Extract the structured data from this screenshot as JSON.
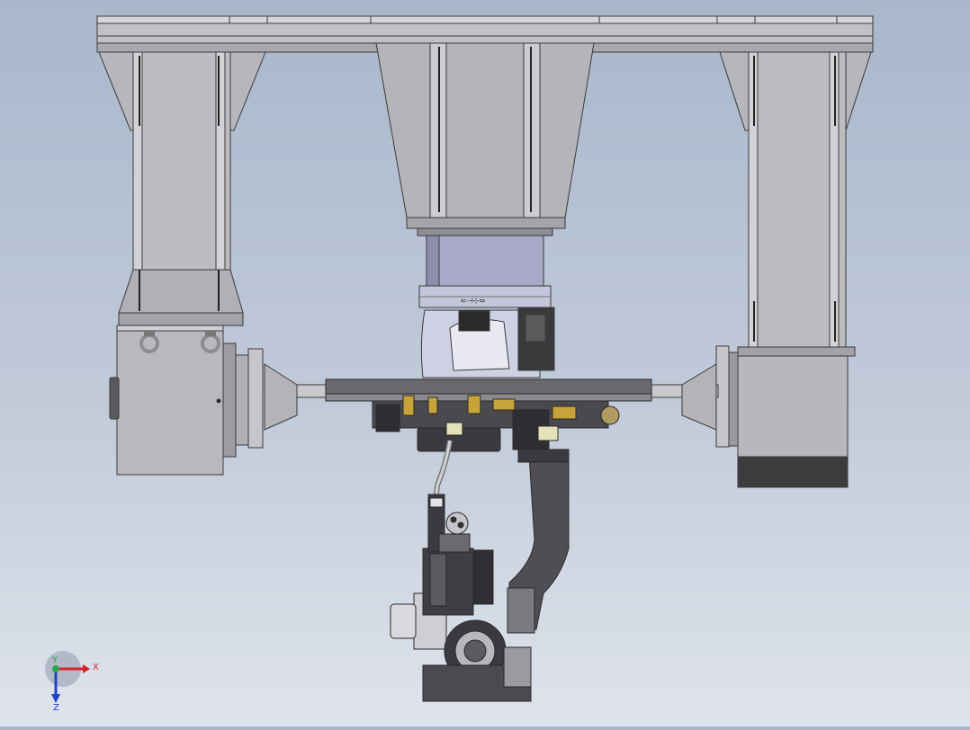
{
  "window": {
    "title": ""
  },
  "view": {
    "type": "cad-assembly-front-view",
    "background_top": "#a9b7cc",
    "background_bottom": "#dfe4ec"
  },
  "triad": {
    "axes": [
      {
        "label": "X",
        "color": "#d8232a"
      },
      {
        "label": "Y",
        "color": "#2aa844"
      },
      {
        "label": "Z",
        "color": "#2140c8"
      }
    ]
  },
  "model": {
    "part_colors": {
      "frame": "#bcbcc0",
      "frame_dark": "#8a8a90",
      "hub_blue": "#a9aac8",
      "rail": "#505050",
      "accent": "#c8a23a",
      "motor_dark": "#3c3c3c"
    },
    "icons": [
      "lifting-eye-icon",
      "cable-icon",
      "welding-torch-icon"
    ]
  }
}
